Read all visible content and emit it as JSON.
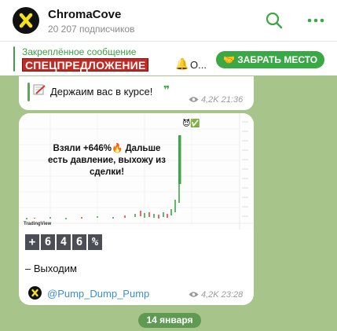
{
  "header": {
    "title": "ChromaCove",
    "subscribers": "20 207 подписчиков"
  },
  "pinned": {
    "label": "Закреплённое сообщение",
    "promo_text": "СПЕЦПРЕДЛОЖЕНИЕ",
    "truncated": "О...",
    "claim_button": "🤝 ЗАБРАТЬ МЕСТО"
  },
  "messages": [
    {
      "text": "Держаим вас в курсе!",
      "quote_mark": "❞",
      "views": "4,2K",
      "time": "21:36"
    },
    {
      "chart_caption": "Взяли +646%🔥 Дальше есть давление, выхожу из сделки!",
      "chart_watermark": "TradingView",
      "chart_badges": "😈✅",
      "percent_chars": [
        "+",
        "6",
        "4",
        "6",
        "%"
      ],
      "body": "– Выходим",
      "source": "@Pump_Dump_Pump",
      "views": "4,2K",
      "time": "23:28"
    }
  ],
  "date_pill": "14 января",
  "colors": {
    "accent_green": "#3aa844",
    "promo_red": "#bf2a24",
    "link_blue": "#3a8fcf",
    "wallpaper": "#a7c48b"
  }
}
